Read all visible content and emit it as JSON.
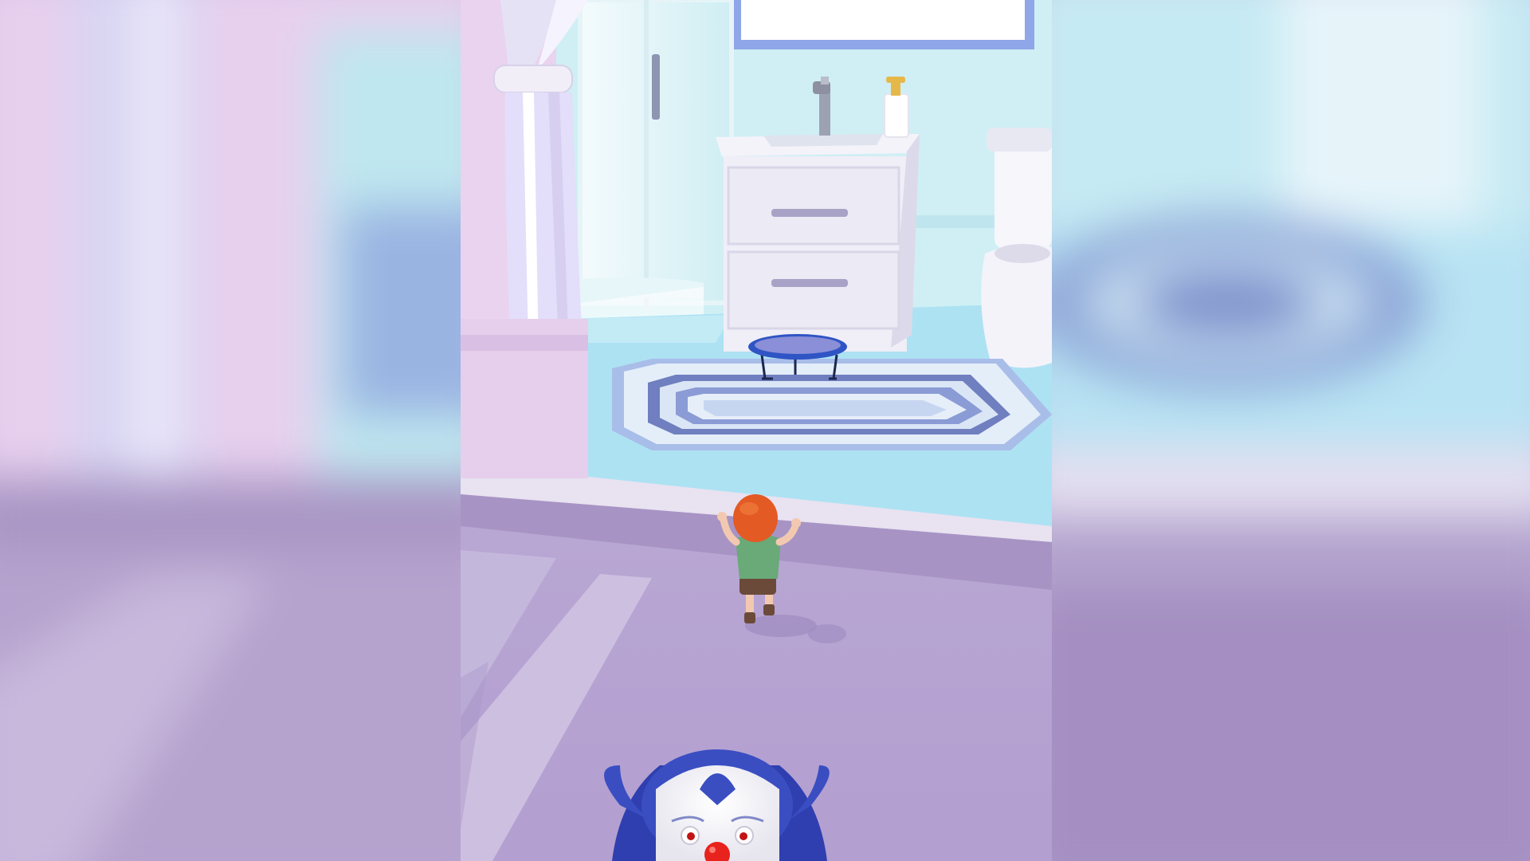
{
  "scene": {
    "name": "bathroom-level",
    "objects": [
      "shower-curtain",
      "glass-shower",
      "sink-vanity",
      "soap-dispenser",
      "toilet",
      "trampoline",
      "striped-rug",
      "mirror",
      "player-boy",
      "clown-chaser"
    ]
  },
  "colors": {
    "wall_pink": "#e9d3ee",
    "wall_blue": "#cdeef3",
    "floor_blue": "#ade2f3",
    "hall_floor": "#b9a6d3",
    "hall_floor_dark": "#a08fc0",
    "trampoline_blue": "#3f63c8",
    "rug_dark": "#6f7fbf",
    "rug_light": "#d6e4f4",
    "boy_hair": "#e35a24",
    "boy_shirt": "#6aa978",
    "boy_shorts": "#6b4a3a",
    "clown_hair": "#3a4ec2",
    "clown_nose": "#e8221c"
  }
}
